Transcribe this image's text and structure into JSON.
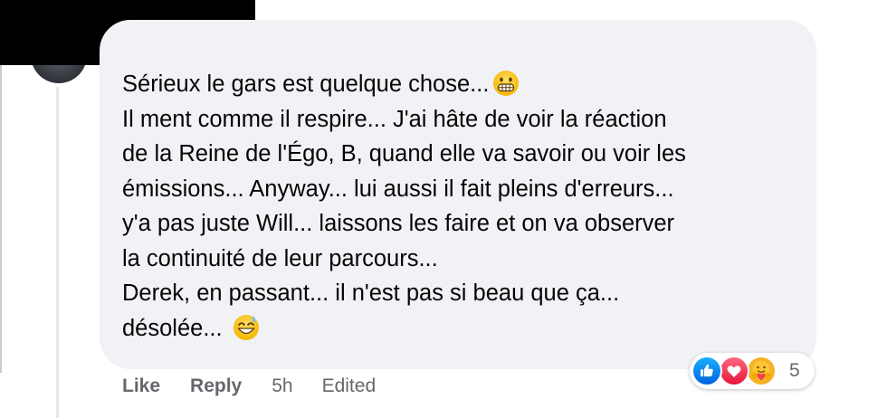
{
  "comment": {
    "lines": [
      "Sérieux le gars est quelque chose...",
      "Il ment comme il respire... J'ai hâte de voir la réaction",
      "de la Reine de l'Égo, B, quand elle va savoir ou voir les",
      "émissions... Anyway... lui aussi il fait pleins d'erreurs...",
      "y'a pas juste Will... laissons les faire et on va observer",
      "la continuité de leur parcours...",
      "Derek, en passant... il n'est pas si beau que ça...",
      "désolée..."
    ],
    "emojis": [
      "grimacing-face",
      "grinning-face-with-sweat"
    ]
  },
  "actions": {
    "like": "Like",
    "reply": "Reply",
    "time": "5h",
    "edited": "Edited"
  },
  "reactions": {
    "types": [
      "like",
      "love",
      "care"
    ],
    "count": "5",
    "colors": {
      "like": "#0866ff",
      "love": "#f33e58",
      "care": "#f7b125"
    }
  },
  "colors": {
    "bubble": "#f0f2f5",
    "text": "#050505",
    "secondary": "#65676b"
  }
}
